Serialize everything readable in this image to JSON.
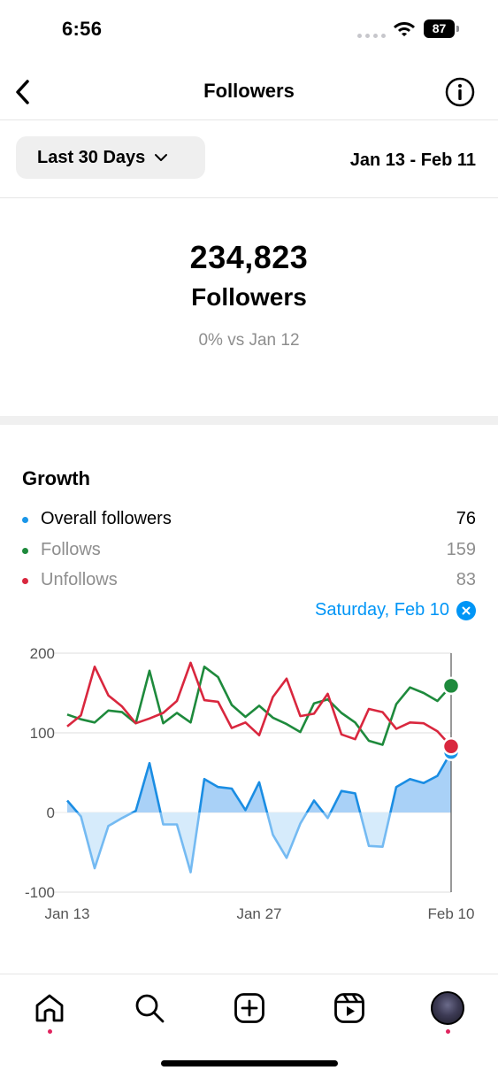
{
  "status_bar": {
    "time": "6:56",
    "battery": "87"
  },
  "header": {
    "title": "Followers"
  },
  "range": {
    "button_label": "Last 30 Days",
    "dates": "Jan 13 - Feb 11"
  },
  "summary": {
    "count": "234,823",
    "label": "Followers",
    "compare": "0% vs Jan 12"
  },
  "growth": {
    "title": "Growth",
    "legend": [
      {
        "name": "Overall followers",
        "value": "76",
        "color": "#1a96e8"
      },
      {
        "name": "Follows",
        "value": "159",
        "color": "#1e8a3c"
      },
      {
        "name": "Unfollows",
        "value": "83",
        "color": "#d9273e"
      }
    ],
    "selected_date": "Saturday, Feb 10"
  },
  "chart_data": {
    "type": "line",
    "x": [
      "Jan 13",
      "Jan 14",
      "Jan 15",
      "Jan 16",
      "Jan 17",
      "Jan 18",
      "Jan 19",
      "Jan 20",
      "Jan 21",
      "Jan 22",
      "Jan 23",
      "Jan 24",
      "Jan 25",
      "Jan 26",
      "Jan 27",
      "Jan 28",
      "Jan 29",
      "Jan 30",
      "Jan 31",
      "Feb 1",
      "Feb 2",
      "Feb 3",
      "Feb 4",
      "Feb 5",
      "Feb 6",
      "Feb 7",
      "Feb 8",
      "Feb 9",
      "Feb 10"
    ],
    "x_tick_labels": [
      "Jan 13",
      "Jan 27",
      "Feb 10"
    ],
    "y_ticks": [
      200,
      100,
      0,
      -100
    ],
    "ylim": [
      -100,
      200
    ],
    "series": [
      {
        "name": "Follows",
        "color": "#1e8a3c",
        "values": [
          123,
          117,
          113,
          128,
          126,
          112,
          178,
          112,
          125,
          113,
          183,
          170,
          135,
          120,
          134,
          119,
          111,
          101,
          137,
          142,
          125,
          113,
          90,
          85,
          136,
          157,
          150,
          140,
          159
        ]
      },
      {
        "name": "Unfollows",
        "color": "#d9273e",
        "values": [
          108,
          122,
          183,
          147,
          133,
          112,
          118,
          125,
          140,
          188,
          141,
          139,
          106,
          113,
          97,
          145,
          168,
          121,
          124,
          149,
          98,
          92,
          130,
          126,
          105,
          113,
          112,
          102,
          83
        ]
      },
      {
        "name": "Overall followers",
        "color": "#1a96e8",
        "values": [
          15,
          -5,
          -70,
          -17,
          -7,
          2,
          62,
          -15,
          -15,
          -75,
          42,
          32,
          30,
          3,
          38,
          -28,
          -57,
          -14,
          15,
          -7,
          27,
          24,
          -42,
          -43,
          32,
          42,
          37,
          46,
          76
        ]
      }
    ],
    "selected_index": 28,
    "grid": true
  }
}
